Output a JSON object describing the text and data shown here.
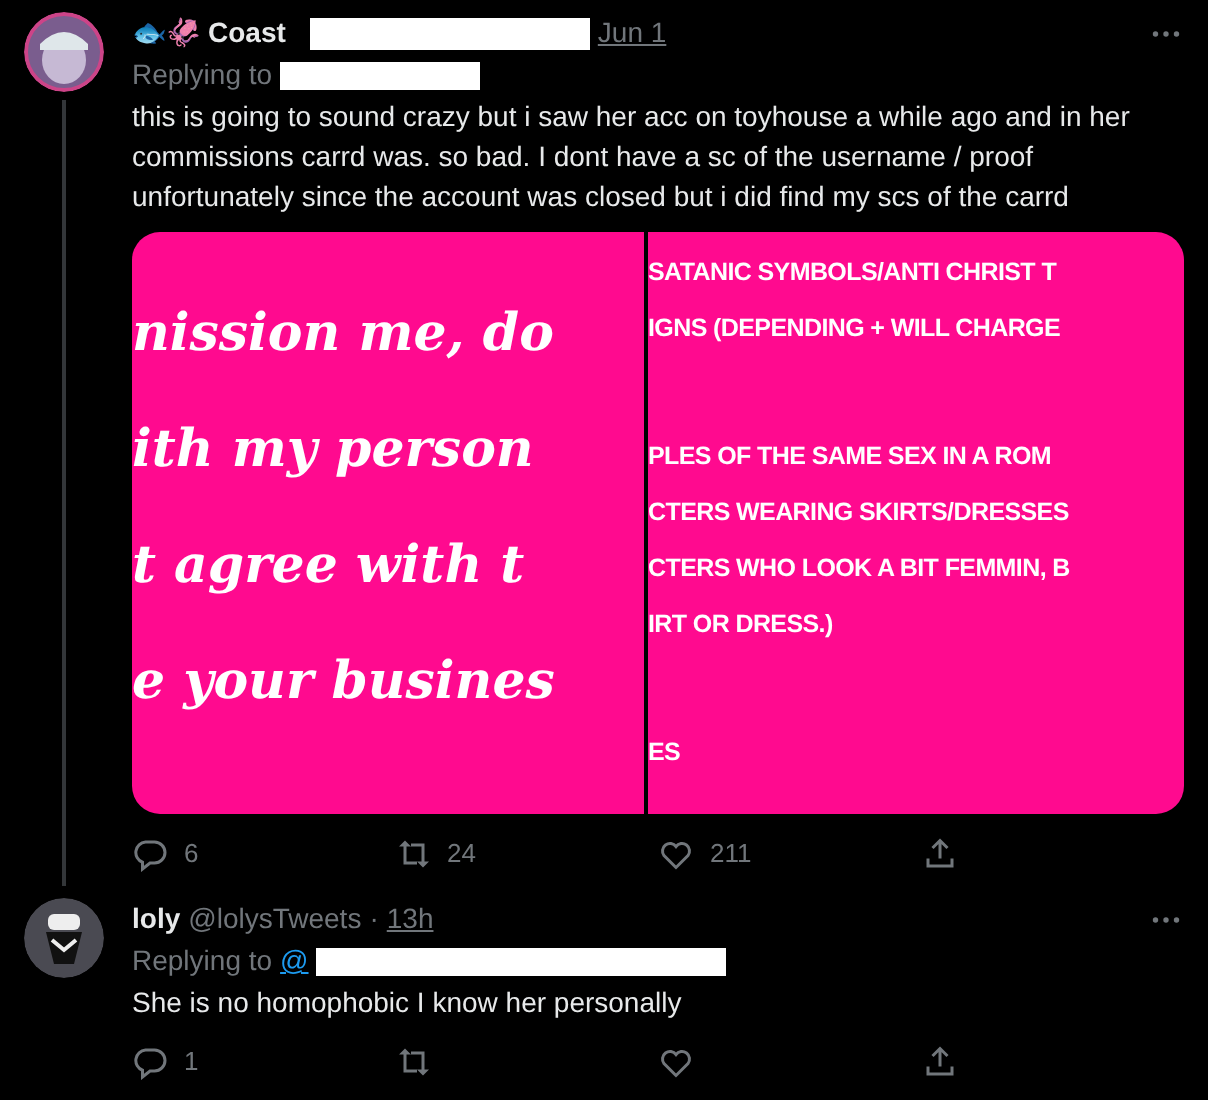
{
  "tweets": [
    {
      "emoji": "🐟🦑",
      "name": "Coast",
      "handle_redacted": true,
      "time": "Jun 1",
      "replying_label": "Replying to",
      "text": "this is going to sound crazy but i saw her acc on toyhouse a while ago and in her commissions carrd  was. so bad. I dont have a sc of the username / proof unfortunately since the account was closed but i did find my scs of the carrd",
      "thread_line": true,
      "media": {
        "left_lines": [
          "nission me, do",
          "ith my person",
          "t agree with t",
          "e your busines"
        ],
        "right_lines": [
          {
            "text": "SATANIC SYMBOLS/ANTI CHRIST T",
            "space_before": false
          },
          {
            "text": "IGNS (DEPENDING + WILL CHARGE",
            "space_before": false
          },
          {
            "text": "PLES OF THE SAME SEX IN A ROM",
            "space_before": true
          },
          {
            "text": "CTERS WEARING SKIRTS/DRESSES",
            "space_before": false
          },
          {
            "text": "CTERS WHO LOOK A BIT FEMMIN, B",
            "space_before": false
          },
          {
            "text": "IRT OR DRESS.)",
            "space_before": false
          },
          {
            "text": "ES",
            "space_before": true
          }
        ]
      },
      "replies": "6",
      "retweets": "24",
      "likes": "211"
    },
    {
      "name": "loly",
      "handle": "@lolysTweets",
      "separator": "·",
      "time": "13h",
      "replying_label": "Replying to",
      "replying_at": "@",
      "text": "She is no homophobic I know her personally",
      "thread_line": false,
      "replies": "1"
    }
  ]
}
